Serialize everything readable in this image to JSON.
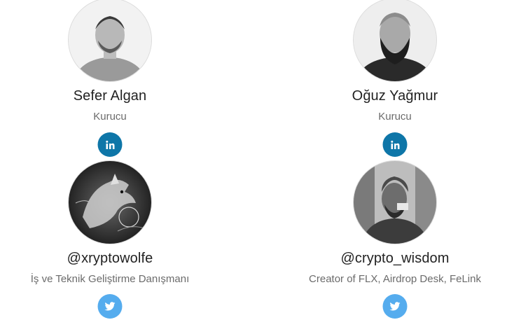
{
  "team": [
    {
      "name": "Sefer Algan",
      "role": "Kurucu",
      "avatar_icon": "person-photo-icon",
      "social": {
        "network": "linkedin",
        "icon": "linkedin-icon",
        "color": "#0e76a8"
      }
    },
    {
      "name": "Oğuz Yağmur",
      "role": "Kurucu",
      "avatar_icon": "person-photo-icon",
      "social": {
        "network": "linkedin",
        "icon": "linkedin-icon",
        "color": "#0e76a8"
      }
    },
    {
      "name": "@xryptowolfe",
      "role": "İş ve Teknik Geliştirme Danışmanı",
      "avatar_icon": "wolf-art-icon",
      "social": {
        "network": "twitter",
        "icon": "twitter-icon",
        "color": "#55acee"
      }
    },
    {
      "name": "@crypto_wisdom",
      "role": "Creator of FLX, Airdrop Desk, FeLink",
      "avatar_icon": "person-photo-icon",
      "social": {
        "network": "twitter",
        "icon": "twitter-icon",
        "color": "#55acee"
      }
    }
  ]
}
